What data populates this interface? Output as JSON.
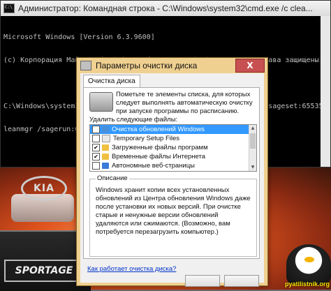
{
  "cmd": {
    "title": "Администратор: Командная строка - C:\\Windows\\system32\\cmd.exe  /c clea...",
    "lines": [
      "Microsoft Windows [Version 6.3.9600]",
      "(c) Корпорация Майкрософт (Microsoft Corporation), 2013. Все права защищены.",
      "",
      "C:\\Windows\\system32>%systemroot%\\system32\\cmd.exe /c cleanmgr /sageset:65535 & c",
      "leanmgr /sagerun:65535"
    ]
  },
  "dialog": {
    "title": "Параметры очистки диска",
    "close_label": "X",
    "tab_label": "Очистка диска",
    "intro_text": "Пометьте те элементы списка, для которых следует выполнять автоматическую очистку при запуске программы по расписанию.",
    "files_label": "Удалить следующие файлы:",
    "files": [
      {
        "label": "Очистка обновлений Windows",
        "checked": false,
        "selected": true,
        "icon_color": "#4a8fd8"
      },
      {
        "label": "Temporary Setup Files",
        "checked": false,
        "selected": false,
        "icon_color": "#e8e8e8"
      },
      {
        "label": "Загруженные файлы программ",
        "checked": true,
        "selected": false,
        "icon_color": "#f0c040"
      },
      {
        "label": "Временные файлы Интернета",
        "checked": true,
        "selected": false,
        "icon_color": "#f0c040"
      },
      {
        "label": "Автономные веб-страницы",
        "checked": false,
        "selected": false,
        "icon_color": "#3a7ad8"
      }
    ],
    "description_legend": "Описание",
    "description_text": "Windows хранит копии всех установленных обновлений из Центра обновления Windows даже после установки их новых версий. При очистке старые и ненужные версии обновлений удаляются или сжимаются. (Возможно, вам потребуется перезагрузить компьютер.)",
    "help_link": "Как работает очистка диска?"
  },
  "wallpaper": {
    "car_badge": "KIA",
    "car_model": "SPORTAGE",
    "watermark": "pyatilistnik.org"
  }
}
